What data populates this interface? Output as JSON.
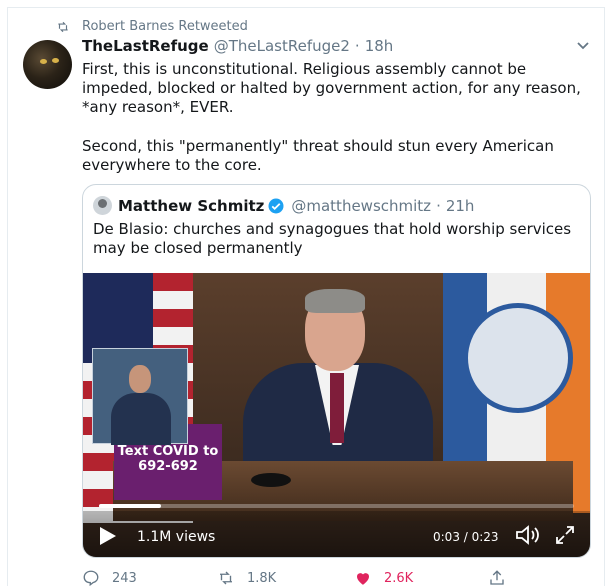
{
  "retweet_context": {
    "text": "Robert Barnes Retweeted",
    "icon": "retweet-icon"
  },
  "tweet": {
    "author_name": "TheLastRefuge",
    "author_handle": "@TheLastRefuge2",
    "separator": "·",
    "time": "18h",
    "text": "First, this is unconstitutional. Religious assembly cannot be impeded, blocked or halted by government action, for any reason, *any reason*, EVER.\n\nSecond, this \"permanently\" threat should stun every American everywhere to the core."
  },
  "quoted_tweet": {
    "author_name": "Matthew Schmitz",
    "author_handle": "@matthewschmitz",
    "separator": "·",
    "time": "21h",
    "verified": true,
    "text": "De Blasio: churches and synagogues that hold worship services may be closed permanently"
  },
  "video": {
    "caption_line1": "Text COVID to",
    "caption_line2": "692-692",
    "views": "1.1M views",
    "time": "0:03 / 0:23",
    "progress": 0.13
  },
  "actions": {
    "reply_count": "243",
    "retweet_count": "1.8K",
    "like_count": "2.6K",
    "liked": true
  },
  "colors": {
    "accent": "#1da1f2",
    "like": "#e0245e",
    "muted": "#657786",
    "caption_bg": "#6a1f6e"
  }
}
